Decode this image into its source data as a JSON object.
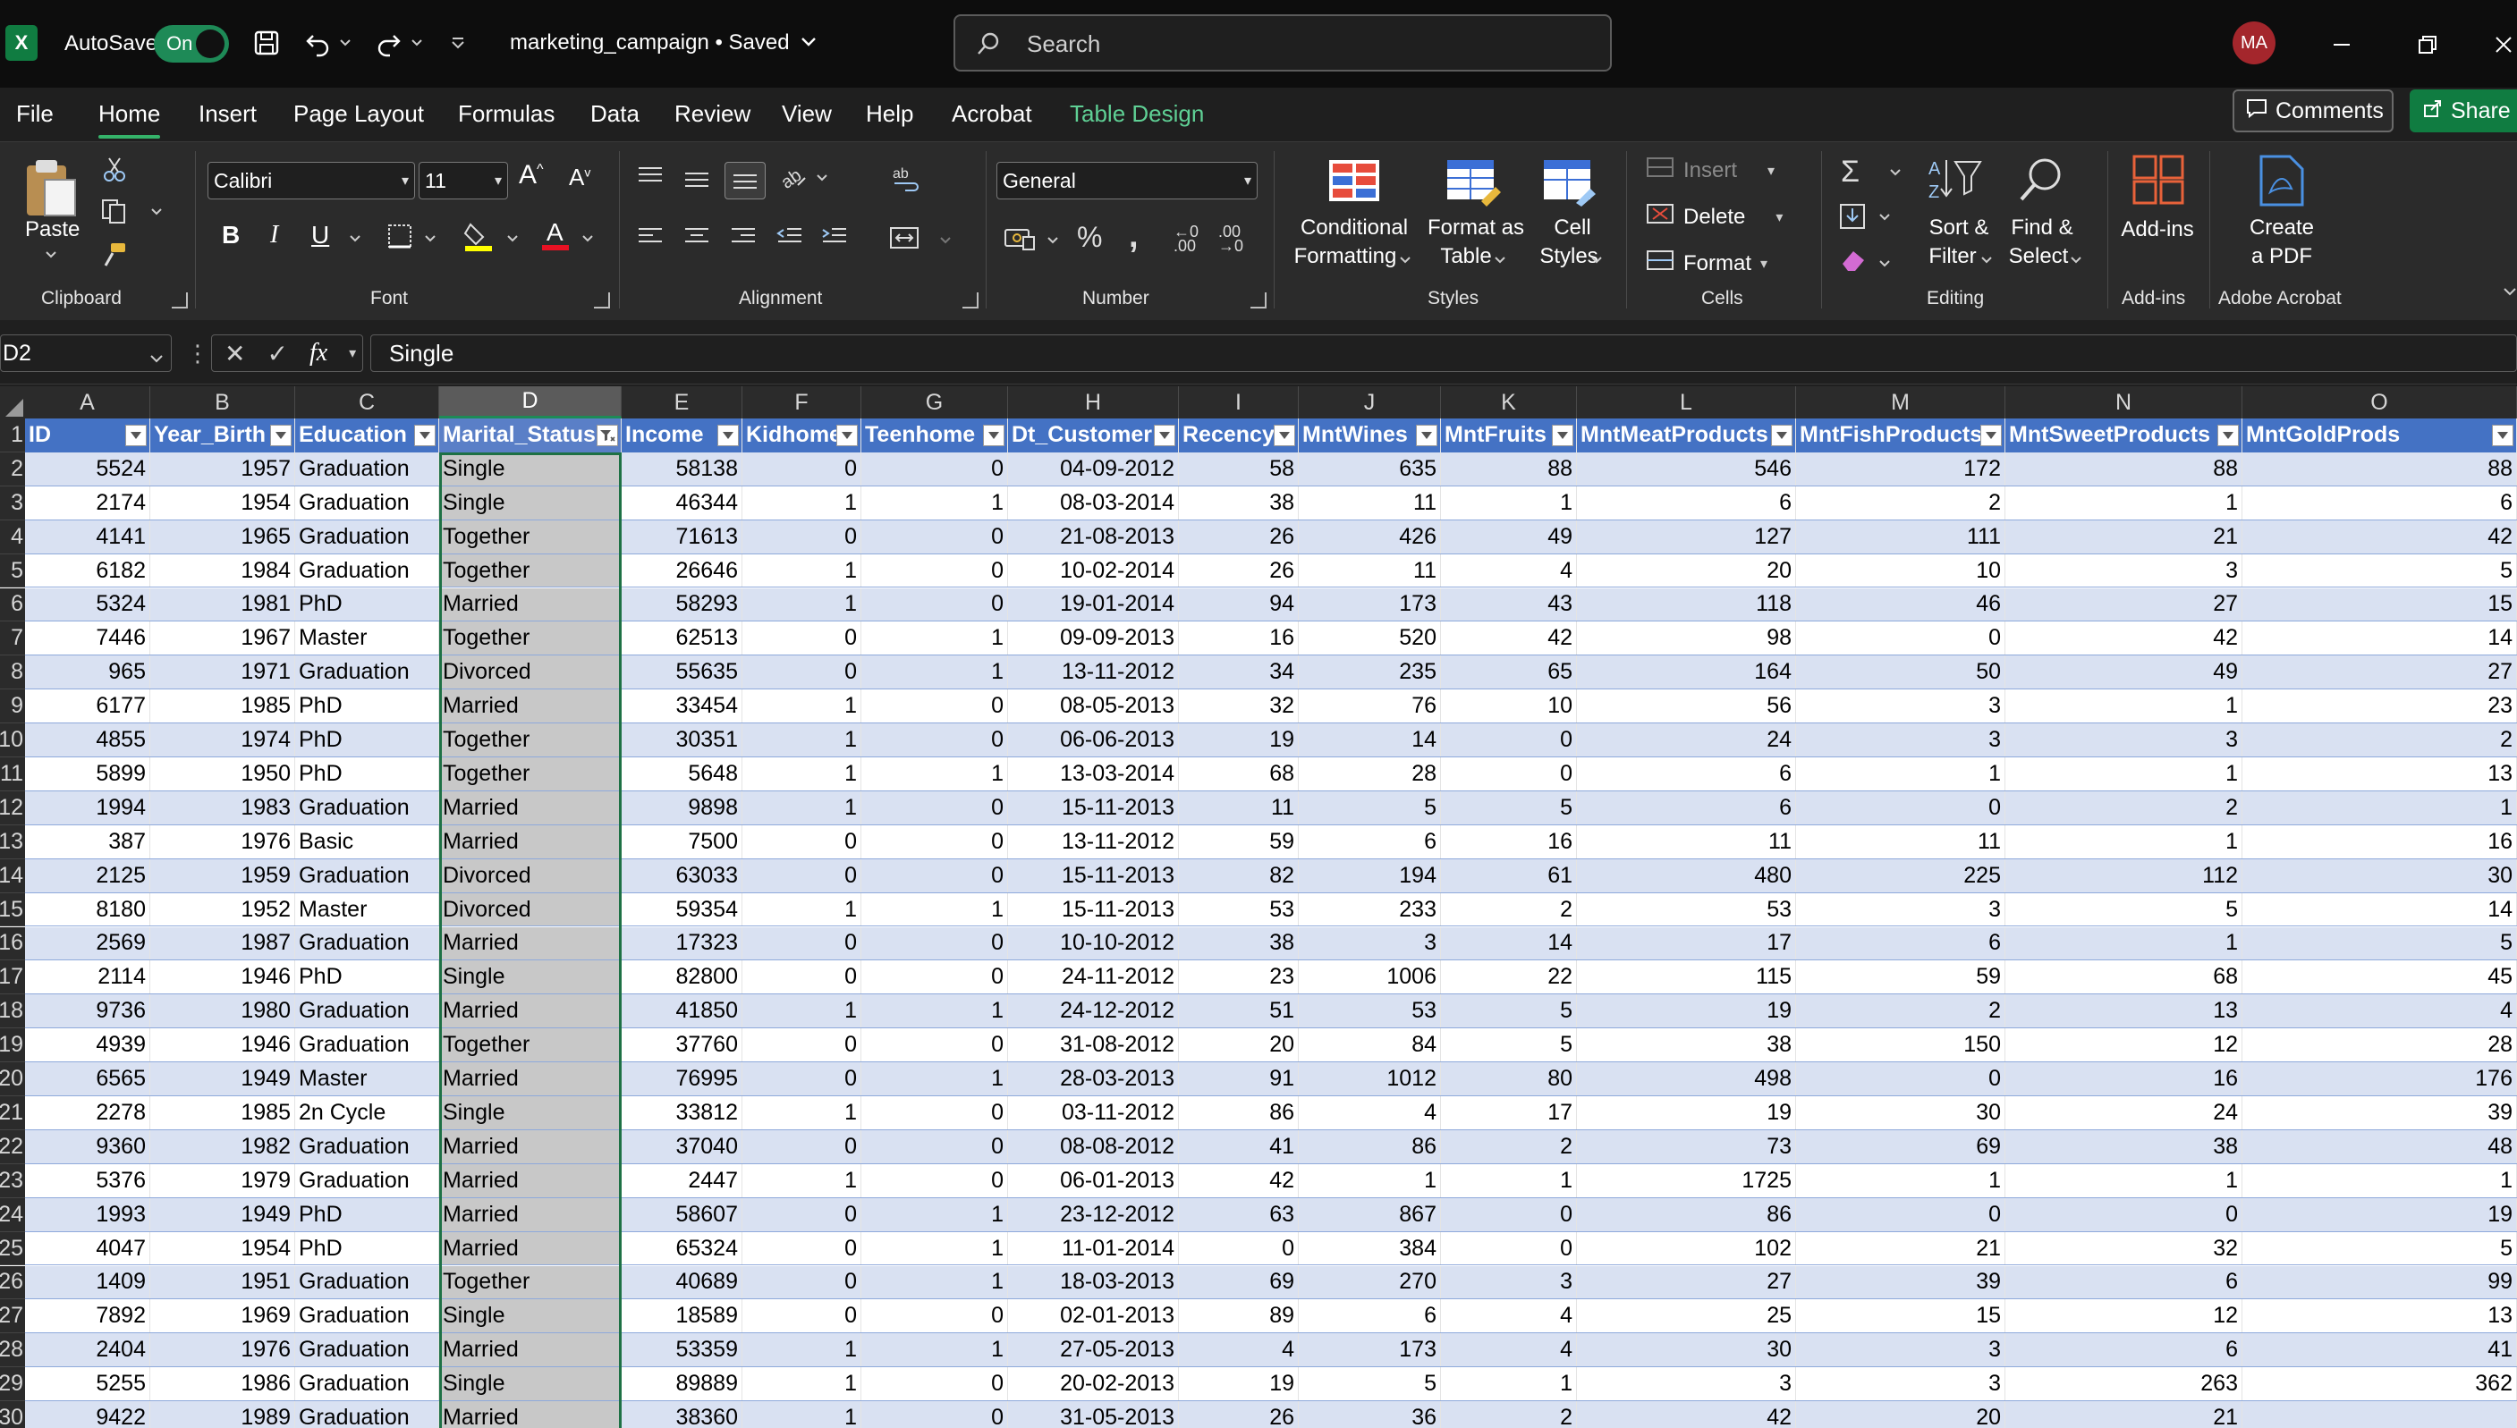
{
  "titlebar": {
    "app_icon_letter": "X",
    "autosave_label": "AutoSave",
    "autosave_state": "On",
    "document_title": "marketing_campaign • Saved",
    "search_placeholder": "Search",
    "avatar_initials": "MA",
    "icons": [
      "save-icon",
      "undo-icon",
      "redo-icon",
      "customize-quick-access-icon",
      "minimize-icon",
      "restore-icon",
      "close-icon"
    ]
  },
  "menu": {
    "tabs": [
      "File",
      "Home",
      "Insert",
      "Page Layout",
      "Formulas",
      "Data",
      "Review",
      "View",
      "Help",
      "Acrobat",
      "Table Design"
    ],
    "active_tab": "Home",
    "comments_label": "Comments",
    "share_label": "Share"
  },
  "ribbon": {
    "clipboard": {
      "label": "Clipboard",
      "paste": "Paste"
    },
    "font": {
      "label": "Font",
      "font_name": "Calibri",
      "font_size": "11"
    },
    "alignment": {
      "label": "Alignment"
    },
    "number": {
      "label": "Number",
      "format": "General"
    },
    "styles": {
      "label": "Styles",
      "conditional_l1": "Conditional",
      "conditional_l2": "Formatting",
      "format_table_l1": "Format as",
      "format_table_l2": "Table",
      "cell_styles_l1": "Cell",
      "cell_styles_l2": "Styles"
    },
    "cells": {
      "label": "Cells",
      "insert": "Insert",
      "delete": "Delete",
      "format": "Format"
    },
    "editing": {
      "label": "Editing",
      "sort_l1": "Sort &",
      "sort_l2": "Filter",
      "find_l1": "Find &",
      "find_l2": "Select"
    },
    "addins": {
      "label": "Add-ins",
      "button": "Add-ins"
    },
    "acrobat": {
      "label": "Adobe Acrobat",
      "create_l1": "Create",
      "create_l2": "a PDF"
    }
  },
  "formula_bar": {
    "cell_ref": "D2",
    "fx_label": "fx",
    "value": "Single"
  },
  "sheet": {
    "columns": [
      "A",
      "B",
      "C",
      "D",
      "E",
      "F",
      "G",
      "H",
      "I",
      "J",
      "K",
      "L",
      "M",
      "N",
      "O"
    ],
    "selected_column": "D",
    "header_row_number": "1",
    "headers": [
      "ID",
      "Year_Birth",
      "Education",
      "Marital_Status",
      "Income",
      "Kidhome",
      "Teenhome",
      "Dt_Customer",
      "Recency",
      "MntWines",
      "MntFruits",
      "MntMeatProducts",
      "MntFishProducts",
      "MntSweetProducts",
      "MntGoldProds"
    ],
    "filtered_column": "Marital_Status",
    "rows": [
      {
        "n": "2",
        "v": [
          "5524",
          "1957",
          "Graduation",
          "Single",
          "58138",
          "0",
          "0",
          "04-09-2012",
          "58",
          "635",
          "88",
          "546",
          "172",
          "88",
          "88"
        ]
      },
      {
        "n": "3",
        "v": [
          "2174",
          "1954",
          "Graduation",
          "Single",
          "46344",
          "1",
          "1",
          "08-03-2014",
          "38",
          "11",
          "1",
          "6",
          "2",
          "1",
          "6"
        ]
      },
      {
        "n": "4",
        "v": [
          "4141",
          "1965",
          "Graduation",
          "Together",
          "71613",
          "0",
          "0",
          "21-08-2013",
          "26",
          "426",
          "49",
          "127",
          "111",
          "21",
          "42"
        ]
      },
      {
        "n": "5",
        "v": [
          "6182",
          "1984",
          "Graduation",
          "Together",
          "26646",
          "1",
          "0",
          "10-02-2014",
          "26",
          "11",
          "4",
          "20",
          "10",
          "3",
          "5"
        ]
      },
      {
        "n": "6",
        "v": [
          "5324",
          "1981",
          "PhD",
          "Married",
          "58293",
          "1",
          "0",
          "19-01-2014",
          "94",
          "173",
          "43",
          "118",
          "46",
          "27",
          "15"
        ]
      },
      {
        "n": "7",
        "v": [
          "7446",
          "1967",
          "Master",
          "Together",
          "62513",
          "0",
          "1",
          "09-09-2013",
          "16",
          "520",
          "42",
          "98",
          "0",
          "42",
          "14"
        ]
      },
      {
        "n": "8",
        "v": [
          "965",
          "1971",
          "Graduation",
          "Divorced",
          "55635",
          "0",
          "1",
          "13-11-2012",
          "34",
          "235",
          "65",
          "164",
          "50",
          "49",
          "27"
        ]
      },
      {
        "n": "9",
        "v": [
          "6177",
          "1985",
          "PhD",
          "Married",
          "33454",
          "1",
          "0",
          "08-05-2013",
          "32",
          "76",
          "10",
          "56",
          "3",
          "1",
          "23"
        ]
      },
      {
        "n": "10",
        "v": [
          "4855",
          "1974",
          "PhD",
          "Together",
          "30351",
          "1",
          "0",
          "06-06-2013",
          "19",
          "14",
          "0",
          "24",
          "3",
          "3",
          "2"
        ]
      },
      {
        "n": "11",
        "v": [
          "5899",
          "1950",
          "PhD",
          "Together",
          "5648",
          "1",
          "1",
          "13-03-2014",
          "68",
          "28",
          "0",
          "6",
          "1",
          "1",
          "13"
        ]
      },
      {
        "n": "12",
        "v": [
          "1994",
          "1983",
          "Graduation",
          "Married",
          "9898",
          "1",
          "0",
          "15-11-2013",
          "11",
          "5",
          "5",
          "6",
          "0",
          "2",
          "1"
        ]
      },
      {
        "n": "13",
        "v": [
          "387",
          "1976",
          "Basic",
          "Married",
          "7500",
          "0",
          "0",
          "13-11-2012",
          "59",
          "6",
          "16",
          "11",
          "11",
          "1",
          "16"
        ]
      },
      {
        "n": "14",
        "v": [
          "2125",
          "1959",
          "Graduation",
          "Divorced",
          "63033",
          "0",
          "0",
          "15-11-2013",
          "82",
          "194",
          "61",
          "480",
          "225",
          "112",
          "30"
        ]
      },
      {
        "n": "15",
        "v": [
          "8180",
          "1952",
          "Master",
          "Divorced",
          "59354",
          "1",
          "1",
          "15-11-2013",
          "53",
          "233",
          "2",
          "53",
          "3",
          "5",
          "14"
        ]
      },
      {
        "n": "16",
        "v": [
          "2569",
          "1987",
          "Graduation",
          "Married",
          "17323",
          "0",
          "0",
          "10-10-2012",
          "38",
          "3",
          "14",
          "17",
          "6",
          "1",
          "5"
        ]
      },
      {
        "n": "17",
        "v": [
          "2114",
          "1946",
          "PhD",
          "Single",
          "82800",
          "0",
          "0",
          "24-11-2012",
          "23",
          "1006",
          "22",
          "115",
          "59",
          "68",
          "45"
        ]
      },
      {
        "n": "18",
        "v": [
          "9736",
          "1980",
          "Graduation",
          "Married",
          "41850",
          "1",
          "1",
          "24-12-2012",
          "51",
          "53",
          "5",
          "19",
          "2",
          "13",
          "4"
        ]
      },
      {
        "n": "19",
        "v": [
          "4939",
          "1946",
          "Graduation",
          "Together",
          "37760",
          "0",
          "0",
          "31-08-2012",
          "20",
          "84",
          "5",
          "38",
          "150",
          "12",
          "28"
        ]
      },
      {
        "n": "20",
        "v": [
          "6565",
          "1949",
          "Master",
          "Married",
          "76995",
          "0",
          "1",
          "28-03-2013",
          "91",
          "1012",
          "80",
          "498",
          "0",
          "16",
          "176"
        ]
      },
      {
        "n": "21",
        "v": [
          "2278",
          "1985",
          "2n Cycle",
          "Single",
          "33812",
          "1",
          "0",
          "03-11-2012",
          "86",
          "4",
          "17",
          "19",
          "30",
          "24",
          "39"
        ]
      },
      {
        "n": "22",
        "v": [
          "9360",
          "1982",
          "Graduation",
          "Married",
          "37040",
          "0",
          "0",
          "08-08-2012",
          "41",
          "86",
          "2",
          "73",
          "69",
          "38",
          "48"
        ]
      },
      {
        "n": "23",
        "v": [
          "5376",
          "1979",
          "Graduation",
          "Married",
          "2447",
          "1",
          "0",
          "06-01-2013",
          "42",
          "1",
          "1",
          "1725",
          "1",
          "1",
          "1"
        ]
      },
      {
        "n": "24",
        "v": [
          "1993",
          "1949",
          "PhD",
          "Married",
          "58607",
          "0",
          "1",
          "23-12-2012",
          "63",
          "867",
          "0",
          "86",
          "0",
          "0",
          "19"
        ]
      },
      {
        "n": "25",
        "v": [
          "4047",
          "1954",
          "PhD",
          "Married",
          "65324",
          "0",
          "1",
          "11-01-2014",
          "0",
          "384",
          "0",
          "102",
          "21",
          "32",
          "5"
        ]
      },
      {
        "n": "26",
        "v": [
          "1409",
          "1951",
          "Graduation",
          "Together",
          "40689",
          "0",
          "1",
          "18-03-2013",
          "69",
          "270",
          "3",
          "27",
          "39",
          "6",
          "99"
        ]
      },
      {
        "n": "27",
        "v": [
          "7892",
          "1969",
          "Graduation",
          "Single",
          "18589",
          "0",
          "0",
          "02-01-2013",
          "89",
          "6",
          "4",
          "25",
          "15",
          "12",
          "13"
        ]
      },
      {
        "n": "28",
        "v": [
          "2404",
          "1976",
          "Graduation",
          "Married",
          "53359",
          "1",
          "1",
          "27-05-2013",
          "4",
          "173",
          "4",
          "30",
          "3",
          "6",
          "41"
        ]
      },
      {
        "n": "29",
        "v": [
          "5255",
          "1986",
          "Graduation",
          "Single",
          "89889",
          "1",
          "0",
          "20-02-2013",
          "19",
          "5",
          "1",
          "3",
          "3",
          "263",
          "362"
        ]
      },
      {
        "n": "30",
        "v": [
          "9422",
          "1989",
          "Graduation",
          "Married",
          "38360",
          "1",
          "0",
          "31-05-2013",
          "26",
          "36",
          "2",
          "42",
          "20",
          "21",
          ""
        ]
      }
    ]
  },
  "colors": {
    "accent_green": "#107c41",
    "table_header_blue": "#4472c4",
    "band_row_light_blue": "#d9e1f2",
    "selected_column_grey": "#c8c8c8"
  }
}
